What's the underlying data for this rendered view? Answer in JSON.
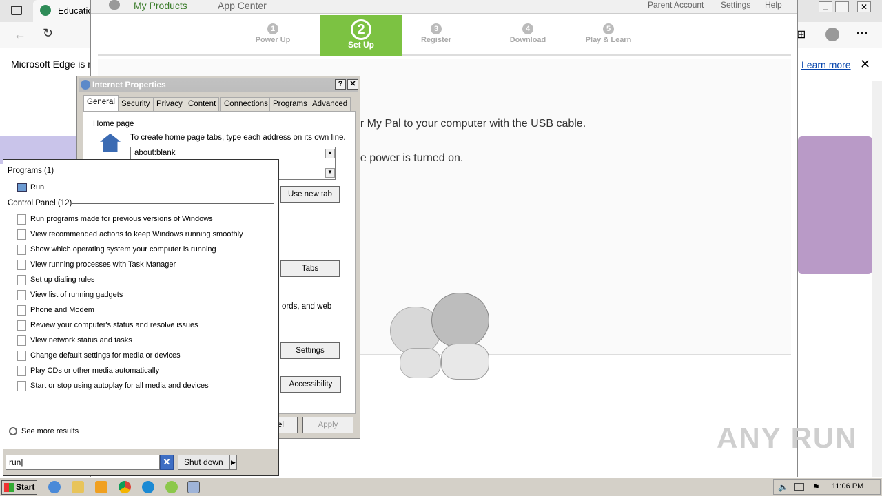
{
  "edge": {
    "tab_title": "Educatio",
    "info_text": "Microsoft Edge is n",
    "learn_more": "Learn more"
  },
  "app": {
    "nav": {
      "my_products": "My Products",
      "app_center": "App Center",
      "parent_account": "Parent Account",
      "settings": "Settings",
      "help": "Help"
    },
    "steps": [
      {
        "num": "1",
        "label": "Power Up"
      },
      {
        "num": "2",
        "label": "Set Up"
      },
      {
        "num": "3",
        "label": "Register"
      },
      {
        "num": "4",
        "label": "Download"
      },
      {
        "num": "5",
        "label": "Play & Learn"
      }
    ],
    "line1": "ur My Pal to your computer with the USB cable.",
    "line2": "he power is turned on."
  },
  "ip": {
    "title": "Internet Properties",
    "help_btn": "?",
    "close_btn": "✕",
    "tabs": [
      "General",
      "Security",
      "Privacy",
      "Content",
      "Connections",
      "Programs",
      "Advanced"
    ],
    "home_page_label": "Home page",
    "home_page_desc": "To create home page tabs, type each address on its own line.",
    "home_url": "about:blank",
    "use_new_tab": "Use new tab",
    "tabs_btn": "Tabs",
    "history_text": "ords, and web",
    "settings_btn": "Settings",
    "accessibility_btn": "Accessibility",
    "cancel_partial": "el",
    "apply_btn": "Apply"
  },
  "start_menu": {
    "programs_header": "Programs (1)",
    "programs": [
      "Run"
    ],
    "control_header": "Control Panel (12)",
    "control_items": [
      "Run programs made for previous versions of Windows",
      "View recommended actions to keep Windows running smoothly",
      "Show which operating system your computer is running",
      "View running processes with Task Manager",
      "Set up dialing rules",
      "View list of running gadgets",
      "Phone and Modem",
      "Review your computer's status and resolve issues",
      "View network status and tasks",
      "Change default settings for media or devices",
      "Play CDs or other media automatically",
      "Start or stop using autoplay for all media and devices"
    ],
    "see_more": "See more results",
    "search_value": "run",
    "shutdown": "Shut down"
  },
  "taskbar": {
    "start": "Start",
    "clock": "11:06 PM"
  },
  "watermark": "ANY RUN",
  "colors": {
    "leapfrog_green": "#7cc242",
    "xp_title": "#bdbdbd"
  }
}
